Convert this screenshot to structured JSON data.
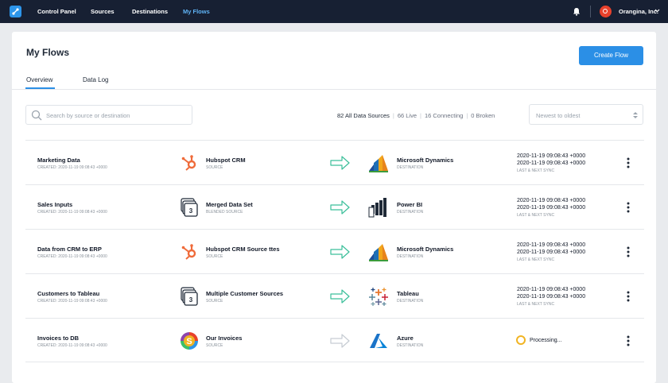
{
  "nav": {
    "items": [
      {
        "label": "Control Panel"
      },
      {
        "label": "Sources"
      },
      {
        "label": "Destinations"
      },
      {
        "label": "My Flows"
      }
    ],
    "org_name": "Orangina, Inc."
  },
  "page": {
    "title": "My Flows",
    "create_button": "Create Flow",
    "tabs": [
      {
        "label": "Overview"
      },
      {
        "label": "Data Log"
      }
    ],
    "active_tab": "Overview"
  },
  "toolbar": {
    "search_placeholder": "Search by source or destination",
    "stats": {
      "total": "82 All Data Sources",
      "live": "66 Live",
      "connecting": "16 Connecting",
      "broken": "0 Broken"
    },
    "sort_value": "Newest to oldest"
  },
  "flows": [
    {
      "name": "Marketing Data",
      "created": "CREATED: 2020-11-19 09:08:43 +0000",
      "source": {
        "name": "Hubspot CRM",
        "type": "SOURCE",
        "icon": "hubspot-icon"
      },
      "destination": {
        "name": "Microsoft Dynamics",
        "type": "DESTINATION",
        "icon": "microsoft-dynamics-icon"
      },
      "sync": {
        "last": "2020-11-19 09:08:43 +0000",
        "next": "2020-11-19 09:08:43 +0000",
        "label": "LAST & NEXT SYNC"
      }
    },
    {
      "name": "Sales Inputs",
      "created": "CREATED: 2020-11-19 09:08:43 +0000",
      "source": {
        "name": "Merged Data Set",
        "type": "BLENDED SOURCE",
        "icon": "stack-icon",
        "badge": "3"
      },
      "destination": {
        "name": "Power BI",
        "type": "DESTINATION",
        "icon": "power-bi-icon"
      },
      "sync": {
        "last": "2020-11-19 09:08:43 +0000",
        "next": "2020-11-19 09:08:43 +0000",
        "label": "LAST & NEXT SYNC"
      }
    },
    {
      "name": "Data from CRM to ERP",
      "created": "CREATED: 2020-11-19 09:08:43 +0000",
      "source": {
        "name": "Hubspot CRM Source ttes",
        "type": "SOURCE",
        "icon": "hubspot-icon"
      },
      "destination": {
        "name": "Microsoft Dynamics",
        "type": "DESTINATION",
        "icon": "microsoft-dynamics-icon"
      },
      "sync": {
        "last": "2020-11-19 09:08:43 +0000",
        "next": "2020-11-19 09:08:43 +0000",
        "label": "LAST & NEXT SYNC"
      }
    },
    {
      "name": "Customers to Tableau",
      "created": "CREATED: 2020-11-19 09:08:43 +0000",
      "source": {
        "name": "Multiple Customer Sources",
        "type": "SOURCE",
        "icon": "stack-icon",
        "badge": "3"
      },
      "destination": {
        "name": "Tableau",
        "type": "DESTINATION",
        "icon": "tableau-icon"
      },
      "sync": {
        "last": "2020-11-19 09:08:43 +0000",
        "next": "2020-11-19 09:08:43 +0000",
        "label": "LAST & NEXT SYNC"
      }
    },
    {
      "name": "Invoices to DB",
      "created": "CREATED: 2020-11-19 09:08:43 +0000",
      "source": {
        "name": "Our Invoices",
        "type": "SOURCE",
        "icon": "s-logo-icon",
        "badge": "S"
      },
      "destination": {
        "name": "Azure",
        "type": "DESTINATION",
        "icon": "azure-icon"
      },
      "status": "Processing..."
    }
  ],
  "colors": {
    "nav_bg": "#172033",
    "accent": "#2b8fe6",
    "arrow_active": "#3bbf9a",
    "arrow_inactive": "#c6ccd3",
    "processing": "#f1b423",
    "hubspot": "#ef6b3a"
  }
}
